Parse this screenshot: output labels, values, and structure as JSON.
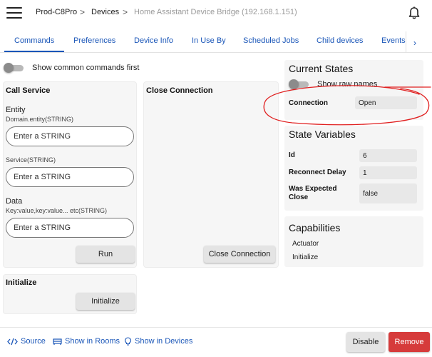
{
  "header": {
    "breadcrumbs": [
      "Prod-C8Pro",
      "Devices",
      "Home Assistant Device Bridge (192.168.1.151)"
    ],
    "separator": ">",
    "menu_icon": "hamburger-menu-icon",
    "bell_icon": "bell-icon"
  },
  "tabs": [
    {
      "label": "Commands",
      "active": true
    },
    {
      "label": "Preferences"
    },
    {
      "label": "Device Info"
    },
    {
      "label": "In Use By"
    },
    {
      "label": "Scheduled Jobs"
    },
    {
      "label": "Child devices"
    },
    {
      "label": "Events"
    }
  ],
  "tabs_next": "›",
  "commands": {
    "toggle_label": "Show common commands first",
    "call_service": {
      "title": "Call Service",
      "entity_label": "Entity",
      "entity_hint": "Domain.entity(STRING)",
      "entity_placeholder": "Enter a STRING",
      "service_hint": "Service(STRING)",
      "service_placeholder": "Enter a STRING",
      "data_label": "Data",
      "data_hint": "Key:value,key:value... etc(STRING)",
      "data_placeholder": "Enter a STRING",
      "run_label": "Run"
    },
    "close_connection": {
      "title": "Close Connection",
      "button_label": "Close Connection"
    },
    "initialize": {
      "title": "Initialize",
      "button_label": "Initialize"
    }
  },
  "current_states": {
    "title": "Current States",
    "toggle_label": "Show raw names",
    "rows": [
      {
        "name": "Connection",
        "value": "Open"
      }
    ]
  },
  "state_variables": {
    "title": "State Variables",
    "rows": [
      {
        "name": "Id",
        "value": "6"
      },
      {
        "name": "Reconnect Delay",
        "value": "1"
      },
      {
        "name": "Was Expected Close",
        "value": "false"
      }
    ]
  },
  "capabilities": {
    "title": "Capabilities",
    "items": [
      "Actuator",
      "Initialize"
    ]
  },
  "footer": {
    "source_label": "Source",
    "rooms_label": "Show in Rooms",
    "devices_label": "Show in Devices",
    "disable_label": "Disable",
    "remove_label": "Remove"
  },
  "colors": {
    "accent": "#1a56b8",
    "danger": "#d63b3b",
    "annotation": "#e02020"
  }
}
